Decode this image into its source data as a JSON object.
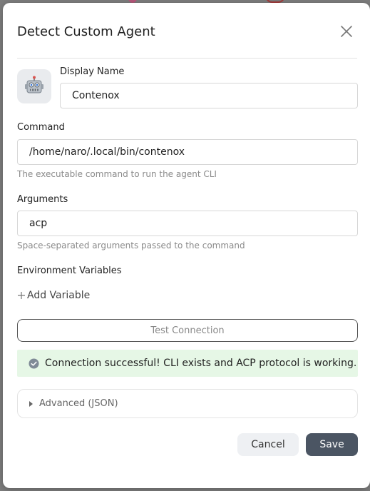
{
  "dialog": {
    "title": "Detect Custom Agent",
    "close_icon": "close-icon"
  },
  "agent": {
    "avatar_icon": "robot-icon",
    "display_name_label": "Display Name",
    "display_name_value": "Contenox"
  },
  "command": {
    "label": "Command",
    "value": "/home/naro/.local/bin/contenox",
    "hint": "The executable command to run the agent CLI"
  },
  "arguments": {
    "label": "Arguments",
    "value": "acp",
    "hint": "Space-separated arguments passed to the command"
  },
  "env": {
    "label": "Environment Variables",
    "add_label": "Add Variable",
    "add_icon": "plus-icon"
  },
  "test": {
    "button_label": "Test Connection",
    "result_text": "Connection successful! CLI exists and ACP protocol is working.",
    "result_icon": "check-circle-icon",
    "success_bg": "#e6f7e6"
  },
  "advanced": {
    "label": "Advanced (JSON)",
    "icon": "caret-right-icon"
  },
  "footer": {
    "cancel_label": "Cancel",
    "save_label": "Save",
    "save_color": "#4b5563"
  }
}
